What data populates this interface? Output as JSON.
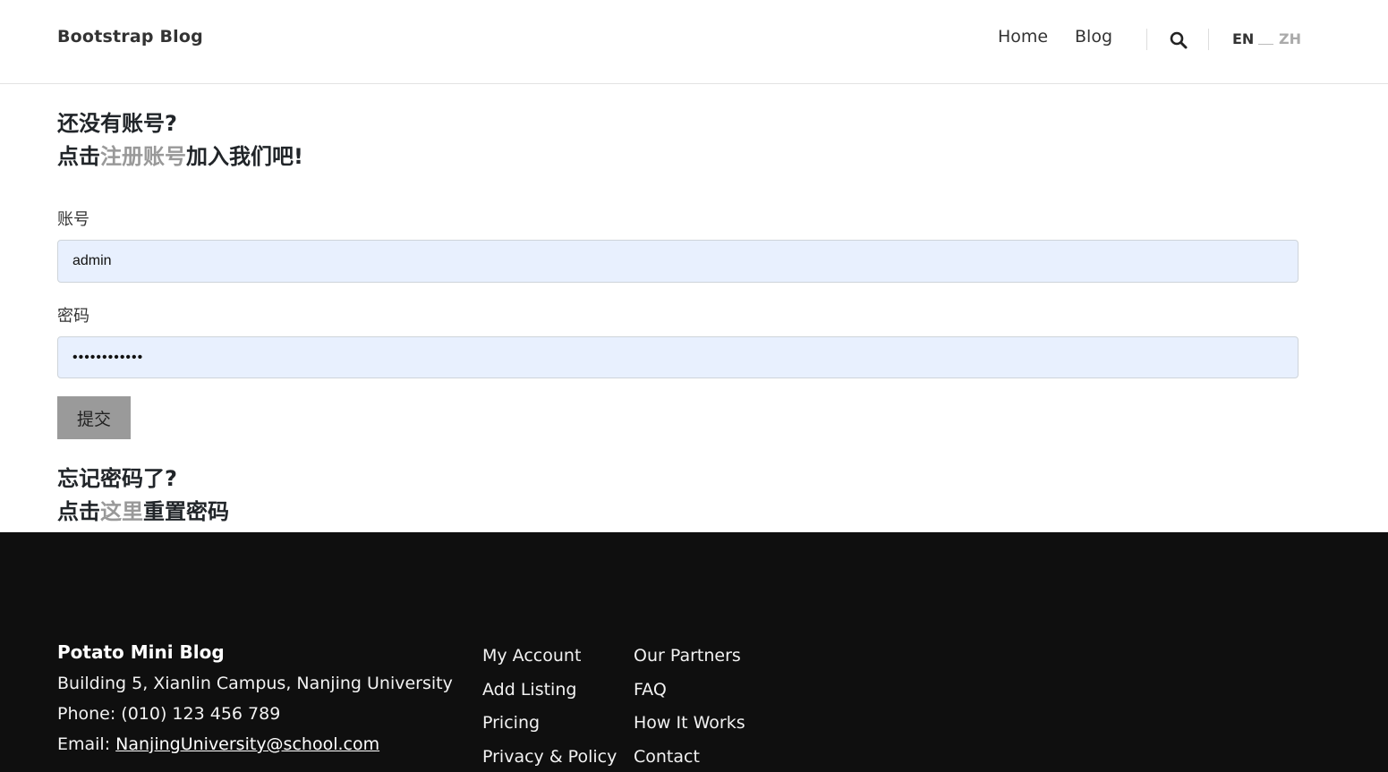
{
  "header": {
    "brand": "Bootstrap Blog",
    "nav": [
      {
        "label": "Home"
      },
      {
        "label": "Blog"
      }
    ],
    "search_icon": "search-icon",
    "lang": {
      "en": "EN",
      "zh": "ZH",
      "active": "EN"
    }
  },
  "login": {
    "signup_line1": "还没有账号?",
    "signup_prefix": "点击",
    "signup_link": "注册账号",
    "signup_suffix": "加入我们吧!",
    "account_label": "账号",
    "account_value": "admin",
    "password_label": "密码",
    "password_value": "••••••••••••",
    "submit_label": "提交",
    "forgot_line1": "忘记密码了?",
    "forgot_prefix": "点击",
    "forgot_link": "这里",
    "forgot_suffix": "重置密码"
  },
  "footer": {
    "title": "Potato Mini Blog",
    "address": "Building 5, Xianlin Campus, Nanjing University",
    "phone": "Phone: (010) 123 456 789",
    "email_prefix": "Email: ",
    "email": "NanjingUniversity@school.com",
    "links_col1": [
      "My Account",
      "Add Listing",
      "Pricing",
      "Privacy & Policy"
    ],
    "links_col2": [
      "Our Partners",
      "FAQ",
      "How It Works",
      "Contact"
    ]
  },
  "colors": {
    "muted_link": "#999999",
    "input_bg": "#e8f0fe",
    "button_bg": "#9a9a9a",
    "footer_bg": "#0f0f0f"
  }
}
